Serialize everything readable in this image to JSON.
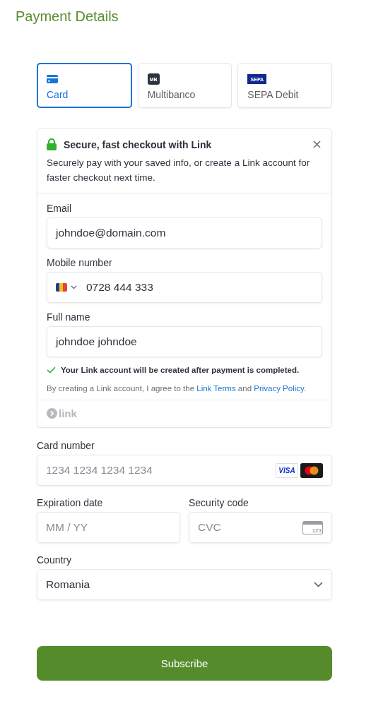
{
  "page": {
    "title": "Payment Details"
  },
  "payment_methods": [
    {
      "kind": "card",
      "label": "Card",
      "selected": true
    },
    {
      "kind": "multibanco",
      "label": "Multibanco",
      "logo_text": "MB",
      "selected": false
    },
    {
      "kind": "sepa",
      "label": "SEPA Debit",
      "logo_text": "SEPA",
      "selected": false
    }
  ],
  "link_panel": {
    "title": "Secure, fast checkout with Link",
    "description": "Securely pay with your saved info, or create a Link account for faster checkout next time.",
    "fields": [
      {
        "kind": "text",
        "label": "Email",
        "value": "johndoe@domain.com"
      },
      {
        "kind": "phone",
        "label": "Mobile number",
        "value": "0728 444 333"
      },
      {
        "kind": "text",
        "label": "Full name",
        "value": "johndoe johndoe"
      }
    ],
    "confirmation": "Your Link account will be created after payment is completed.",
    "terms": [
      {
        "kind": "text",
        "text": "By creating a Link account, I agree to the "
      },
      {
        "kind": "link",
        "text": "Link Terms"
      },
      {
        "kind": "text",
        "text": " and "
      },
      {
        "kind": "link",
        "text": "Privacy Policy"
      },
      {
        "kind": "text",
        "text": "."
      }
    ],
    "brand": "link"
  },
  "card_form": {
    "card_number": {
      "label": "Card number",
      "placeholder": "1234 1234 1234 1234",
      "brands": [
        {
          "kind": "visa",
          "text": "VISA"
        },
        {
          "kind": "mastercard"
        }
      ]
    },
    "expiration": {
      "label": "Expiration date",
      "placeholder": "MM / YY"
    },
    "security_code": {
      "label": "Security code",
      "placeholder": "CVC",
      "icon_text": "123"
    },
    "country": {
      "label": "Country",
      "value": "Romania"
    }
  },
  "submit": {
    "label": "Subscribe"
  }
}
